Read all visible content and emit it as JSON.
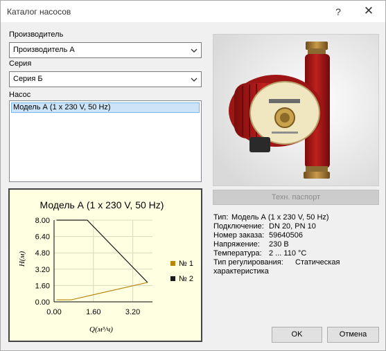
{
  "window": {
    "title": "Каталог насосов",
    "help_label": "?",
    "close_label": "✕"
  },
  "manufacturer": {
    "label": "Производитель",
    "value": "Производитель А"
  },
  "series": {
    "label": "Серия",
    "value": "Серия Б"
  },
  "pump": {
    "label": "Насос",
    "items": [
      "Модель А (1 x 230 V, 50 Hz)"
    ]
  },
  "passport_button": "Техн. паспорт",
  "details": [
    {
      "key": "Тип:",
      "value": "Модель А (1 x 230 V, 50 Hz)"
    },
    {
      "key": "Подключение:",
      "value": "DN 20, PN 10"
    },
    {
      "key": "Номер заказа:",
      "value": "59640506"
    },
    {
      "key": "Напряжение:",
      "value": "230 В"
    },
    {
      "key": "Температура:",
      "value": "2 ... 110 °С"
    },
    {
      "key": "Тип регулирования:",
      "value": "Статическая"
    }
  ],
  "details_wrap": "характеристика",
  "ok_button": "OK",
  "cancel_button": "Отмена",
  "colors": {
    "series1": "#b8860b",
    "series2": "#1a1a1a",
    "chart_bg": "#ffffe1"
  },
  "chart_data": {
    "type": "line",
    "title": "Модель А (1 x 230 V, 50 Hz)",
    "xlabel": "Q(м³/ч)",
    "ylabel": "H(м)",
    "xlim": [
      0,
      4.0
    ],
    "ylim": [
      0,
      8.0
    ],
    "xticks": [
      "0.00",
      "1.60",
      "3.20"
    ],
    "yticks": [
      "0.00",
      "1.60",
      "3.20",
      "4.80",
      "6.40",
      "8.00"
    ],
    "legend_position": "right",
    "series": [
      {
        "name": "№ 1",
        "x": [
          0.1,
          0.7,
          3.8
        ],
        "y": [
          0.2,
          0.2,
          1.9
        ]
      },
      {
        "name": "№ 2",
        "x": [
          0.1,
          1.35,
          3.8
        ],
        "y": [
          8.0,
          8.0,
          1.9
        ]
      }
    ]
  }
}
